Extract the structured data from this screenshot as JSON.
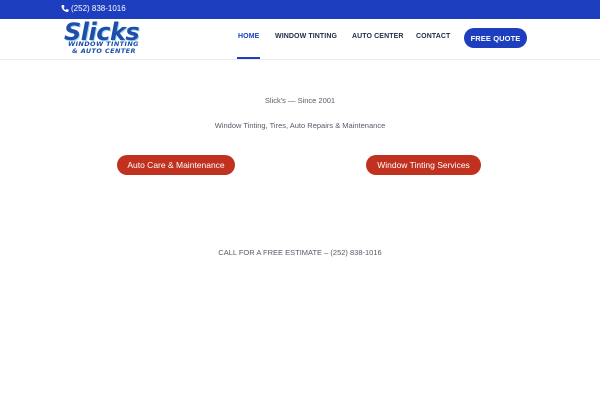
{
  "topbar": {
    "phone": "(252) 838-1016",
    "phone_icon": "phone-icon"
  },
  "logo": {
    "wordmark": "Slicks",
    "line1": "WINDOW TINTING",
    "line2": "& AUTO CENTER",
    "brand_color": "#1e4ea8"
  },
  "nav": {
    "items": [
      {
        "label": "HOME",
        "active": true
      },
      {
        "label": "WINDOW TINTING",
        "active": false
      },
      {
        "label": "AUTO CENTER",
        "active": false
      },
      {
        "label": "CONTACT",
        "active": false
      }
    ],
    "cta_label": "FREE QUOTE"
  },
  "main": {
    "tagline_1": "Slick's — Since 2001",
    "tagline_2": "Window Tinting, Tires, Auto Repairs & Maintenance",
    "buttons": {
      "auto_care": "Auto Care & Maintenance",
      "window_tinting": "Window Tinting Services"
    },
    "estimate": {
      "label": "CALL FOR A FREE ESTIMATE –",
      "phone": "(252) 838-1016"
    }
  },
  "colors": {
    "primary_blue": "#1d3fbf",
    "cta_red": "#c0321f",
    "text_gray": "#555c66"
  }
}
